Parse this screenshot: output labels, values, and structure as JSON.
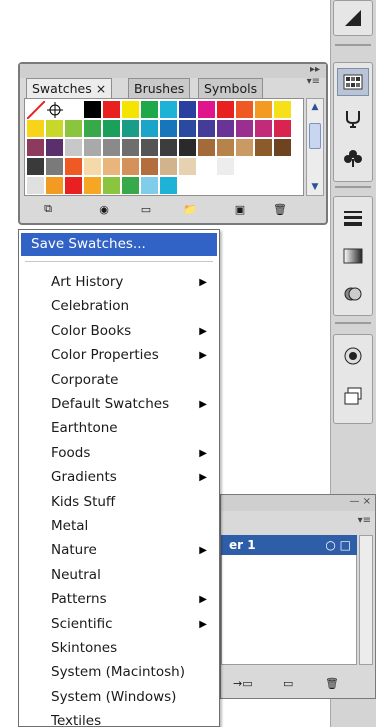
{
  "dock": {
    "icons": [
      "gradient-icon",
      "swatches-icon",
      "symbols-icon",
      "club-icon",
      "stroke-icon",
      "transparency-icon",
      "appearance-icon",
      "graphic-styles-icon",
      "layers-icon"
    ]
  },
  "swatches_panel": {
    "tabs": [
      {
        "label": "Swatches ×",
        "active": true
      },
      {
        "label": "Brushes",
        "active": false
      },
      {
        "label": "Symbols",
        "active": false
      }
    ],
    "menu_glyph": "▸▸",
    "swatch_rows": [
      [
        "none",
        "#ffffff",
        "#ffffff",
        "#000000",
        "#e8201f",
        "#f5e400",
        "#1fa84a",
        "#1eb3d6",
        "#2a3fa0",
        "#e0148c",
        "#e8201f",
        "#ef5a24",
        "#f39a22",
        "#f6e01a"
      ],
      [
        "#f7d31a",
        "#c8d82a",
        "#8bc53f",
        "#37a94a",
        "#1aa05a",
        "#1a9d86",
        "#1ba6c9",
        "#1776bb",
        "#2b4a9f",
        "#443c98",
        "#6b3396",
        "#9b2f8f",
        "#c22a7a",
        "#d92450"
      ],
      [
        "#8e3a5e",
        "#5b2f6b",
        "#c8c8c8",
        "#a9a9a9",
        "#8a8a8a",
        "#6e6e6e",
        "#555555",
        "#3d3d3d",
        "#2a2a2a",
        "#a36a3a",
        "#b8824b",
        "#c99a63",
        "#8c5b2c",
        "#6e4420"
      ],
      [
        "#3a3a3a",
        "#7a7a7a",
        "#ef5a24",
        "#f5d9a8",
        "#e8b67a",
        "#d4925a",
        "#b46d3c",
        "#d2b48c",
        "#e6d2b0",
        "#ffffff",
        "#ededed",
        "#ffffff",
        "#ffffff",
        "#ffffff"
      ],
      [
        "#e0e0e0",
        "#f39a22",
        "#e8201f",
        "#f5a623",
        "#8bc53f",
        "#37a94a",
        "#7fcde8",
        "#1eb3d6",
        "#ffffff",
        "#ffffff",
        "#ffffff",
        "#ffffff",
        "#ffffff",
        "#ffffff"
      ]
    ],
    "footer_icons": [
      "swatch-libraries-icon",
      "show-kinds-icon",
      "swatch-options-icon",
      "new-color-group-icon",
      "new-swatch-icon",
      "delete-swatch-icon"
    ]
  },
  "menu": {
    "items": [
      {
        "label": "Save Swatches...",
        "submenu": false,
        "highlighted": true
      },
      {
        "label": "Art History",
        "submenu": true
      },
      {
        "label": "Celebration",
        "submenu": false
      },
      {
        "label": "Color Books",
        "submenu": true
      },
      {
        "label": "Color Properties",
        "submenu": true
      },
      {
        "label": "Corporate",
        "submenu": false
      },
      {
        "label": "Default Swatches",
        "submenu": true
      },
      {
        "label": "Earthtone",
        "submenu": false
      },
      {
        "label": "Foods",
        "submenu": true
      },
      {
        "label": "Gradients",
        "submenu": true
      },
      {
        "label": "Kids Stuff",
        "submenu": false
      },
      {
        "label": "Metal",
        "submenu": false
      },
      {
        "label": "Nature",
        "submenu": true
      },
      {
        "label": "Neutral",
        "submenu": false
      },
      {
        "label": "Patterns",
        "submenu": true
      },
      {
        "label": "Scientific",
        "submenu": true
      },
      {
        "label": "Skintones",
        "submenu": false
      },
      {
        "label": "System (Macintosh)",
        "submenu": false
      },
      {
        "label": "System (Windows)",
        "submenu": false
      },
      {
        "label": "Textiles",
        "submenu": false
      }
    ],
    "arrow_glyph": "▶"
  },
  "layers_panel": {
    "close_glyph": "— ×",
    "selected_row_label": "er 1",
    "row_glyph": "○ □"
  },
  "colors": {
    "highlight": "#3162c6",
    "panel_bg": "#d9d9d9",
    "selected_row": "#2f5ea8"
  }
}
